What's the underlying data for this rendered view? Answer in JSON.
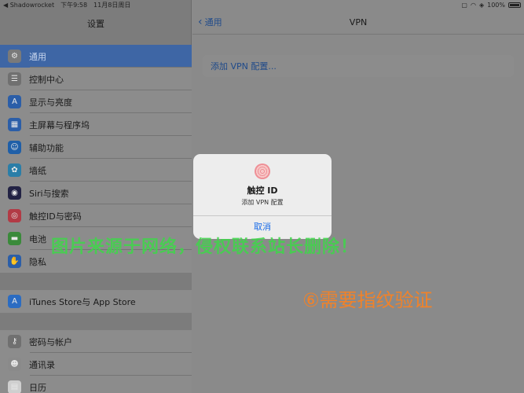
{
  "status_bar": {
    "left_app": "◀ Shadowrocket",
    "time": "下午9:58",
    "date": "11月8日周日",
    "battery": "100%"
  },
  "sidebar": {
    "title": "设置",
    "groups": [
      {
        "items": [
          {
            "label": "通用",
            "icon": "gear-icon",
            "color": "#7a7a7a",
            "active": true
          },
          {
            "label": "控制中心",
            "icon": "toggle-icon",
            "color": "#707070"
          },
          {
            "label": "显示与亮度",
            "icon": "text-size-icon",
            "color": "#2b5ea8"
          },
          {
            "label": "主屏幕与程序坞",
            "icon": "grid-icon",
            "color": "#2b5ea8"
          },
          {
            "label": "辅助功能",
            "icon": "accessibility-icon",
            "color": "#1f5fa8"
          },
          {
            "label": "墙纸",
            "icon": "flower-icon",
            "color": "#2a7ea8"
          },
          {
            "label": "Siri与搜索",
            "icon": "siri-icon",
            "color": "#222244"
          },
          {
            "label": "触控ID与密码",
            "icon": "fingerprint-icon",
            "color": "#b23a45"
          },
          {
            "label": "电池",
            "icon": "battery-icon",
            "color": "#3a8a3a"
          },
          {
            "label": "隐私",
            "icon": "hand-icon",
            "color": "#2b5ea8"
          }
        ]
      },
      {
        "items": [
          {
            "label": "iTunes Store与 App Store",
            "icon": "app-store-icon",
            "color": "#2b6cc2"
          }
        ]
      },
      {
        "items": [
          {
            "label": "密码与帐户",
            "icon": "key-icon",
            "color": "#707070"
          },
          {
            "label": "通讯录",
            "icon": "contacts-icon",
            "color": "#8a8a8a"
          },
          {
            "label": "日历",
            "icon": "calendar-icon",
            "color": "#cfcfcf"
          }
        ]
      }
    ]
  },
  "detail": {
    "back_label": "通用",
    "title": "VPN",
    "add_vpn_label": "添加 VPN 配置..."
  },
  "alert": {
    "title": "触控 ID",
    "message": "添加 VPN 配置",
    "cancel_label": "取消"
  },
  "overlay": {
    "watermark": "图片来源于网络，侵权联系站长删除！",
    "step_text": "⑥需要指纹验证"
  }
}
